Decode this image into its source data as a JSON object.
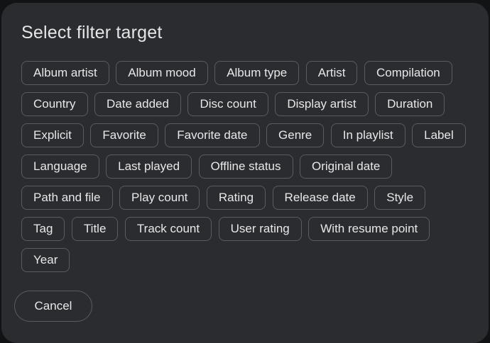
{
  "dialog": {
    "title": "Select filter target",
    "chips": [
      "Album artist",
      "Album mood",
      "Album type",
      "Artist",
      "Compilation",
      "Country",
      "Date added",
      "Disc count",
      "Display artist",
      "Duration",
      "Explicit",
      "Favorite",
      "Favorite date",
      "Genre",
      "In playlist",
      "Label",
      "Language",
      "Last played",
      "Offline status",
      "Original date",
      "Path and file",
      "Play count",
      "Rating",
      "Release date",
      "Style",
      "Tag",
      "Title",
      "Track count",
      "User rating",
      "With resume point",
      "Year"
    ],
    "cancel_label": "Cancel"
  },
  "colors": {
    "dialog_bg": "#2b2c2f",
    "chip_border": "#5a5c61",
    "text": "#e8e8ea"
  }
}
